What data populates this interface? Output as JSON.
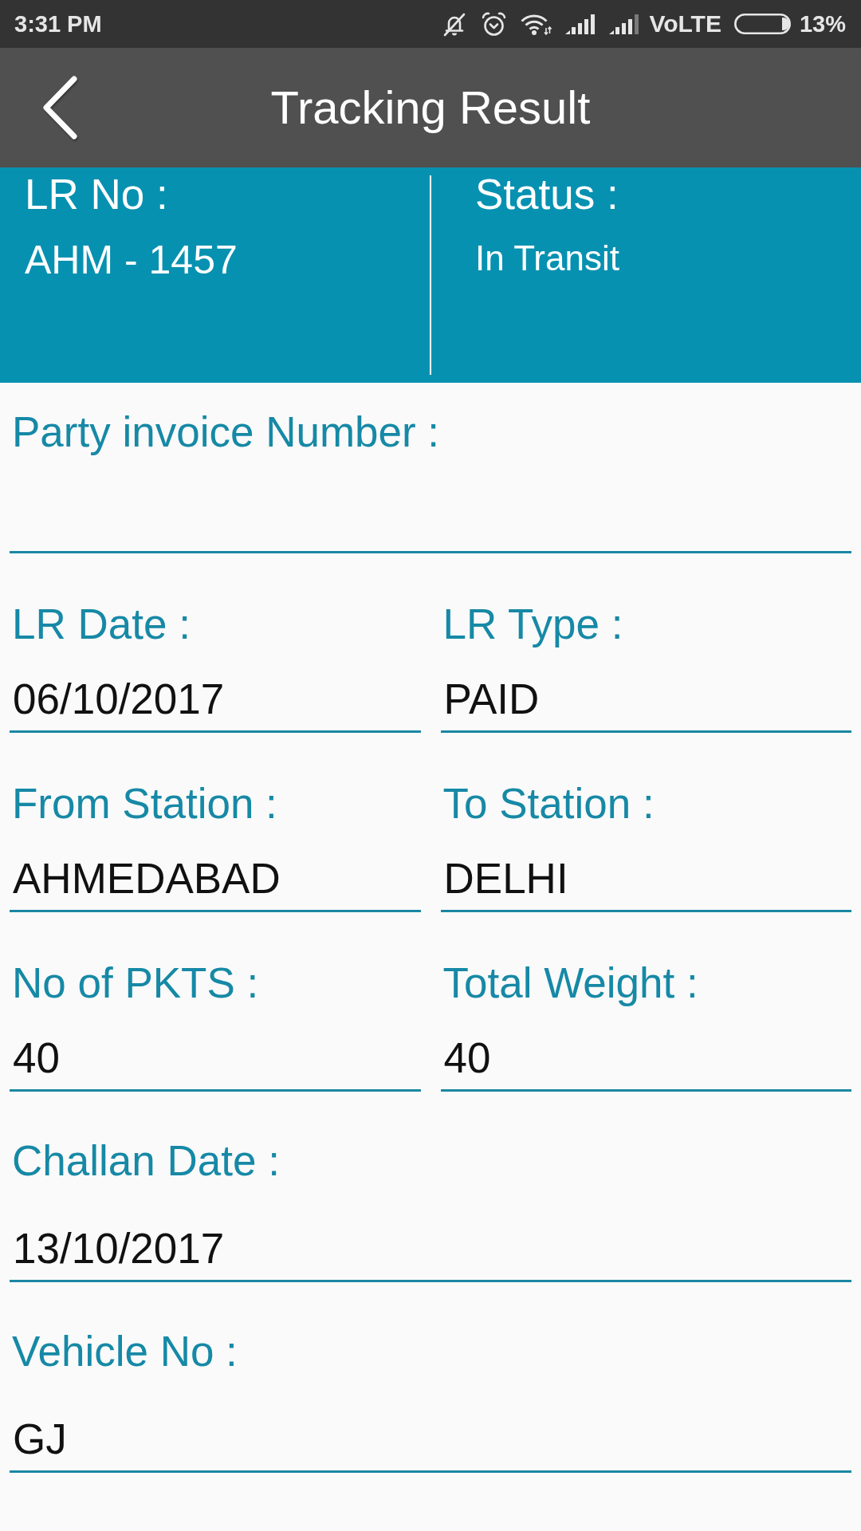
{
  "status_bar": {
    "time": "3:31 PM",
    "network_label": "VoLTE",
    "battery_percent": "13%"
  },
  "app_bar": {
    "title": "Tracking Result"
  },
  "summary": [
    {
      "label": "LR No :",
      "value": "AHM - 1457"
    },
    {
      "label": "Status :",
      "value": "In Transit"
    }
  ],
  "form_rows": [
    [
      {
        "label": "Party invoice Number :"
      }
    ],
    [
      {
        "label": "LR Date :",
        "value": "06/10/2017"
      },
      {
        "label": "LR Type :",
        "value": "PAID"
      }
    ],
    [
      {
        "label": "From Station :",
        "value": "AHMEDABAD"
      },
      {
        "label": "To Station :",
        "value": "DELHI"
      }
    ],
    [
      {
        "label": "No of PKTS :",
        "value": "40"
      },
      {
        "label": "Total Weight :",
        "value": "40"
      }
    ],
    [
      {
        "label": "Challan Date :",
        "value": "13/10/2017"
      }
    ],
    [
      {
        "label": "Vehicle No :",
        "value": "GJ"
      }
    ]
  ]
}
